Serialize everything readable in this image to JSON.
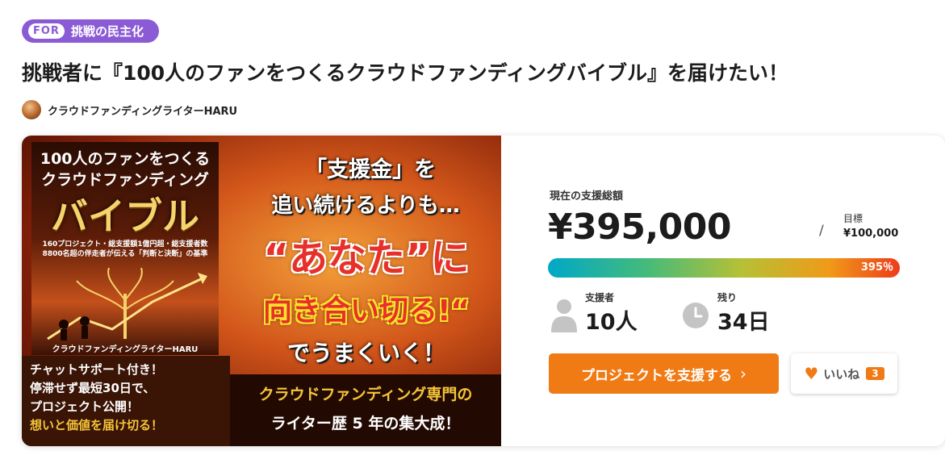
{
  "tag": {
    "prefix": "FOR",
    "label": "挑戦の民主化"
  },
  "project": {
    "title": "挑戦者に『100人のファンをつくるクラウドファンディングバイブル』を届けたい！",
    "owner": "クラウドファンディングライターHARU"
  },
  "banner": {
    "book_title_1": "100人のファンをつくる",
    "book_title_2": "クラウドファンディング",
    "book_title_3": "バイブル",
    "book_subtitle": "160プロジェクト・総支援額1億円超・総支援者数8800名超の伴走者が伝える「判断と決断」の基準",
    "book_author": "クラウドファンディングライターHARU",
    "catch_1": "「支援金」を",
    "catch_2": "追い続けるよりも…",
    "catch_3": "“あなた”に",
    "catch_4": "向き合い切る!“",
    "catch_5": "でうまくいく！",
    "chat_lines": [
      "チャットサポート付き！",
      "停滞せず最短30日で、",
      "プロジェクト公開！",
      "想いと価値を届け切る！"
    ],
    "bottom_1": "クラウドファンディング専門の",
    "bottom_2": "ライター歴 5 年の集大成！"
  },
  "stats": {
    "total_label": "現在の支援総額",
    "total": "¥395,000",
    "goal_label": "目標",
    "goal": "¥100,000",
    "slash": "/",
    "percent_label": "395％",
    "percent": 395,
    "supporters_label": "支援者",
    "supporters": "10人",
    "remaining_label": "残り",
    "remaining": "34日"
  },
  "actions": {
    "back_label": "プロジェクトを支援する",
    "back_chevron": "›",
    "like_label": "いいね",
    "like_count": "3"
  },
  "colors": {
    "accent": "#f07a14",
    "tag": "#8b5bd6"
  }
}
